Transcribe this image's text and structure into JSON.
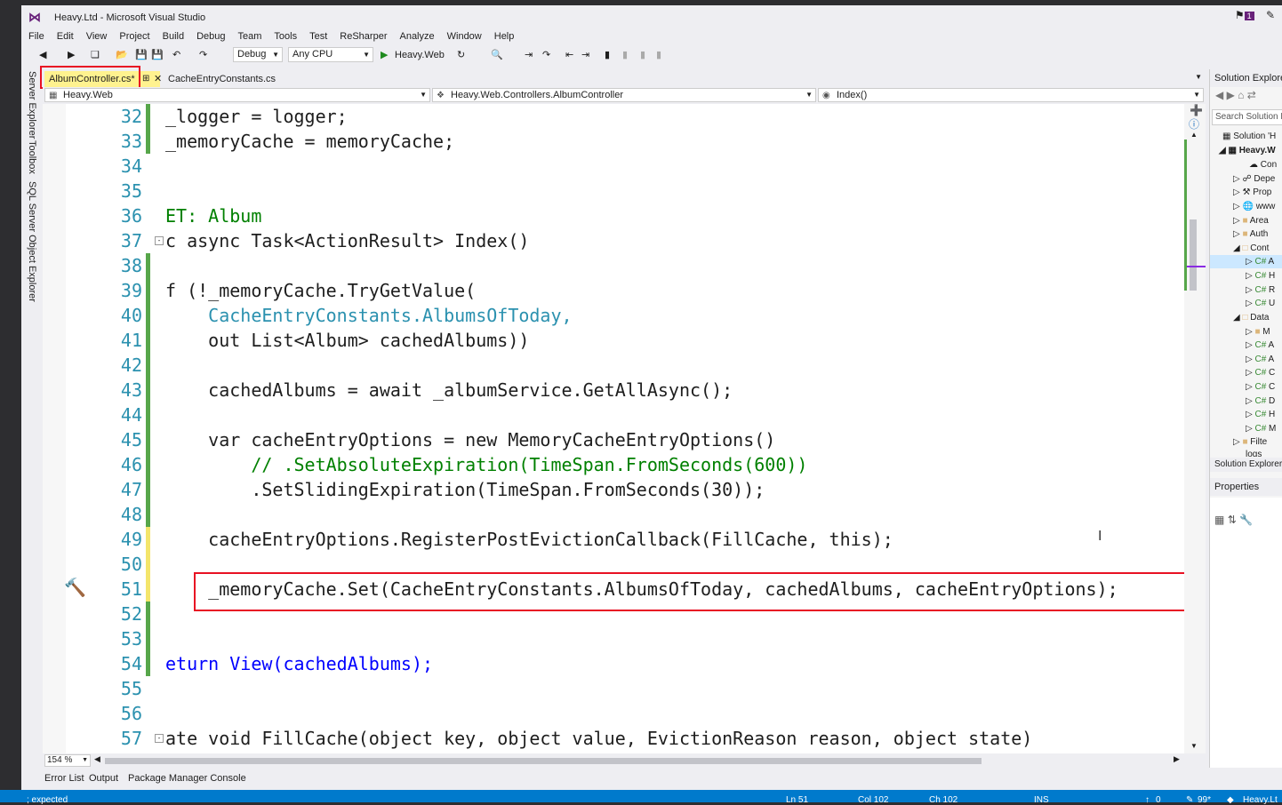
{
  "window": {
    "title": "Heavy.Ltd - Microsoft Visual Studio",
    "notifications": "1"
  },
  "menu": [
    "File",
    "Edit",
    "View",
    "Project",
    "Build",
    "Debug",
    "Team",
    "Tools",
    "Test",
    "ReSharper",
    "Analyze",
    "Window",
    "Help"
  ],
  "toolbar": {
    "config": "Debug",
    "platform": "Any CPU",
    "start_label": "Heavy.Web"
  },
  "left_tabs": [
    "Server Explorer",
    "Toolbox",
    "SQL Server Object Explorer"
  ],
  "doc_tabs": [
    {
      "label": "AlbumController.cs*",
      "active": true
    },
    {
      "label": "CacheEntryConstants.cs",
      "active": false
    }
  ],
  "nav": {
    "project": "Heavy.Web",
    "class": "Heavy.Web.Controllers.AlbumController",
    "member": "Index()"
  },
  "editor": {
    "zoom": "154 %",
    "lines": [
      {
        "n": "32",
        "text": "_logger = logger;"
      },
      {
        "n": "33",
        "text": "_memoryCache = memoryCache;"
      },
      {
        "n": "34",
        "text": ""
      },
      {
        "n": "35",
        "text": ""
      },
      {
        "n": "36",
        "text": "ET: Album"
      },
      {
        "n": "37",
        "text": "c async Task<ActionResult> Index()"
      },
      {
        "n": "38",
        "text": ""
      },
      {
        "n": "39",
        "text": "f (!_memoryCache.TryGetValue("
      },
      {
        "n": "40",
        "text": "    CacheEntryConstants.AlbumsOfToday,"
      },
      {
        "n": "41",
        "text": "    out List<Album> cachedAlbums))"
      },
      {
        "n": "42",
        "text": ""
      },
      {
        "n": "43",
        "text": "    cachedAlbums = await _albumService.GetAllAsync();"
      },
      {
        "n": "44",
        "text": ""
      },
      {
        "n": "45",
        "text": "    var cacheEntryOptions = new MemoryCacheEntryOptions()"
      },
      {
        "n": "46",
        "text": "        // .SetAbsoluteExpiration(TimeSpan.FromSeconds(600))"
      },
      {
        "n": "47",
        "text": "        .SetSlidingExpiration(TimeSpan.FromSeconds(30));"
      },
      {
        "n": "48",
        "text": ""
      },
      {
        "n": "49",
        "text": "    cacheEntryOptions.RegisterPostEvictionCallback(FillCache, this);"
      },
      {
        "n": "50",
        "text": ""
      },
      {
        "n": "51",
        "text": "    _memoryCache.Set(CacheEntryConstants.AlbumsOfToday, cachedAlbums, cacheEntryOptions);"
      },
      {
        "n": "52",
        "text": ""
      },
      {
        "n": "53",
        "text": ""
      },
      {
        "n": "54",
        "text": "eturn View(cachedAlbums);"
      },
      {
        "n": "55",
        "text": ""
      },
      {
        "n": "56",
        "text": ""
      },
      {
        "n": "57",
        "text": "ate void FillCache(object key, object value, EvictionReason reason, object state)"
      }
    ]
  },
  "bottom_tabs": [
    "Error List",
    "Output",
    "Package Manager Console"
  ],
  "status": {
    "message": "; expected",
    "ln": "Ln 51",
    "col": "Col 102",
    "ch": "Ch 102",
    "mode": "INS",
    "up": "0",
    "down": "99*",
    "branch": "Heavy.Lt"
  },
  "solution_explorer": {
    "title": "Solution Explorer",
    "search_placeholder": "Search Solution E",
    "footer": "Solution Explorer",
    "items": [
      "Solution 'H",
      "Heavy.W",
      "Con",
      "Depe",
      "Prop",
      "www",
      "Area",
      "Auth",
      "Cont",
      "A",
      "H",
      "R",
      "U",
      "Data",
      "M",
      "A",
      "A",
      "C",
      "C",
      "D",
      "H",
      "M",
      "Filte",
      "logs"
    ]
  },
  "properties": {
    "title": "Properties"
  }
}
